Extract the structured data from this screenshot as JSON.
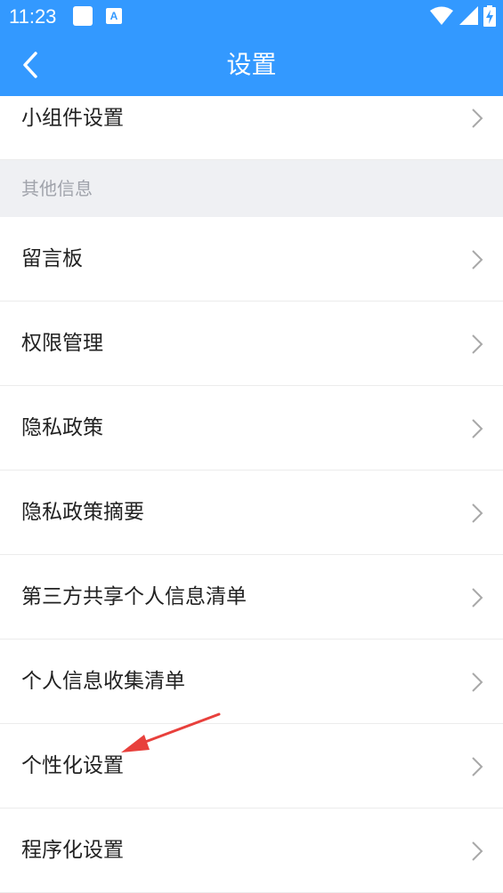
{
  "status_bar": {
    "time": "11:23",
    "notification_glyph": "A"
  },
  "header": {
    "title": "设置"
  },
  "items_top": [
    {
      "label": "小组件设置"
    }
  ],
  "section": {
    "label": "其他信息"
  },
  "items": [
    {
      "label": "留言板"
    },
    {
      "label": "权限管理"
    },
    {
      "label": "隐私政策"
    },
    {
      "label": "隐私政策摘要"
    },
    {
      "label": "第三方共享个人信息清单"
    },
    {
      "label": "个人信息收集清单"
    },
    {
      "label": "个性化设置"
    },
    {
      "label": "程序化设置"
    }
  ],
  "colors": {
    "primary": "#3399ff",
    "section_bg": "#eff0f3",
    "annotation_arrow": "#e8403c"
  }
}
